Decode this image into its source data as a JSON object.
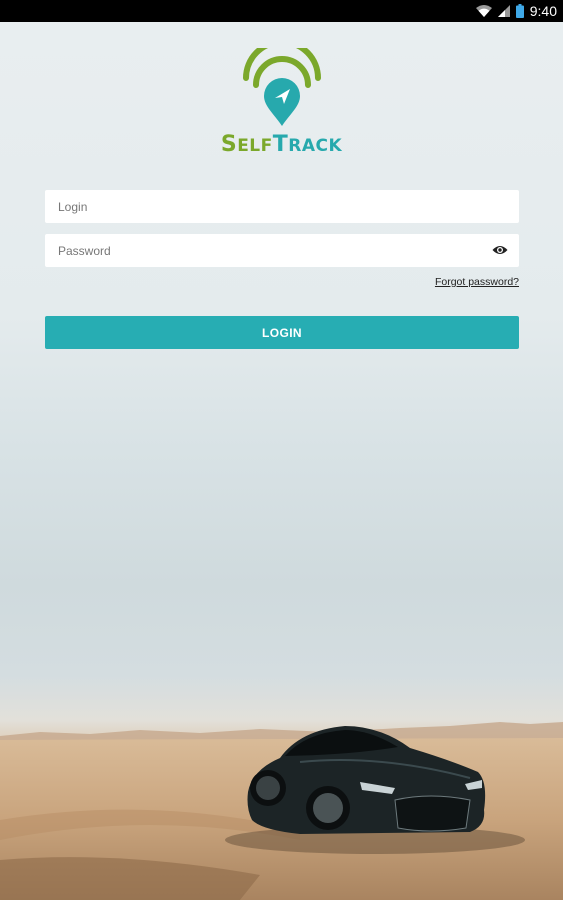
{
  "status_bar": {
    "time": "9:40",
    "icons": [
      "wifi-icon",
      "signal-icon",
      "battery-icon"
    ]
  },
  "app": {
    "brand_self": "Self",
    "brand_track": "Track",
    "brand_colors": {
      "green": "#7ba82b",
      "teal": "#27a9ad"
    },
    "logo_icon": "location-pin-wifi-icon"
  },
  "form": {
    "login_placeholder": "Login",
    "login_value": "",
    "password_placeholder": "Password",
    "password_value": "",
    "show_password_icon": "eye-icon",
    "forgot_password": "Forgot password?",
    "login_button": "LOGIN",
    "button_color": "#27adb3"
  },
  "background": {
    "description_icon": "sports-car-desert-image"
  }
}
